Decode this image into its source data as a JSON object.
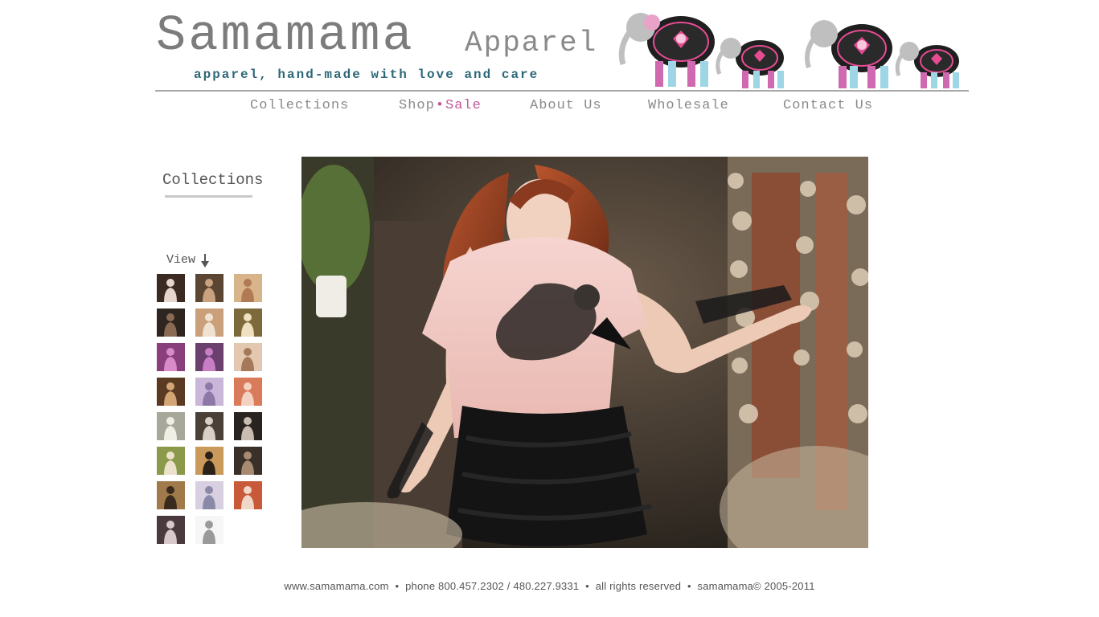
{
  "brand": {
    "name": "Samamama",
    "sub": "Apparel",
    "tagline": "apparel, hand-made with love and care"
  },
  "nav": {
    "collections": "Collections",
    "shop": "Shop",
    "sale": "Sale",
    "about": "About Us",
    "wholesale": "Wholesale",
    "contact": "Contact Us"
  },
  "sidebar": {
    "title": "Collections",
    "view_label": "View"
  },
  "thumbnails": [
    {
      "bg": "#3a2a22",
      "fg": "#e6d5cc"
    },
    {
      "bg": "#5a4632",
      "fg": "#c9a27f"
    },
    {
      "bg": "#d9b48a",
      "fg": "#b07a55"
    },
    {
      "bg": "#2e2420",
      "fg": "#8a6a52"
    },
    {
      "bg": "#c9a07a",
      "fg": "#f0e2d2"
    },
    {
      "bg": "#7d6a3a",
      "fg": "#efe0c0"
    },
    {
      "bg": "#8a3f7d",
      "fg": "#d98ac9"
    },
    {
      "bg": "#6b3f6e",
      "fg": "#c77ec4"
    },
    {
      "bg": "#e3c8b0",
      "fg": "#a6785a"
    },
    {
      "bg": "#5a3a22",
      "fg": "#d4a574"
    },
    {
      "bg": "#c9b6d8",
      "fg": "#8d78a8"
    },
    {
      "bg": "#d97a5a",
      "fg": "#f3d2c2"
    },
    {
      "bg": "#a8a89a",
      "fg": "#f0efe6"
    },
    {
      "bg": "#4a4038",
      "fg": "#d8cfc6"
    },
    {
      "bg": "#2a2420",
      "fg": "#c9bdb2"
    },
    {
      "bg": "#8a9a4a",
      "fg": "#ece2cc"
    },
    {
      "bg": "#c99a5a",
      "fg": "#2a2218"
    },
    {
      "bg": "#3a302a",
      "fg": "#a88a70"
    },
    {
      "bg": "#a07a4a",
      "fg": "#3a2a1e"
    },
    {
      "bg": "#d8d0e0",
      "fg": "#8a8aa8"
    },
    {
      "bg": "#c85a3a",
      "fg": "#f0d8c8"
    },
    {
      "bg": "#4a3a3e",
      "fg": "#d8c8cc"
    },
    {
      "bg": "#f6f6f6",
      "fg": "#9a9a9a"
    }
  ],
  "footer": {
    "site": "www.samamama.com",
    "phone": "phone 800.457.2302 / 480.227.9331",
    "rights": "all rights reserved",
    "copyright": "samamama© 2005-2011"
  },
  "colors": {
    "accent": "#c0589a",
    "tagline": "#2e6878",
    "nav": "#8a8a8a"
  }
}
